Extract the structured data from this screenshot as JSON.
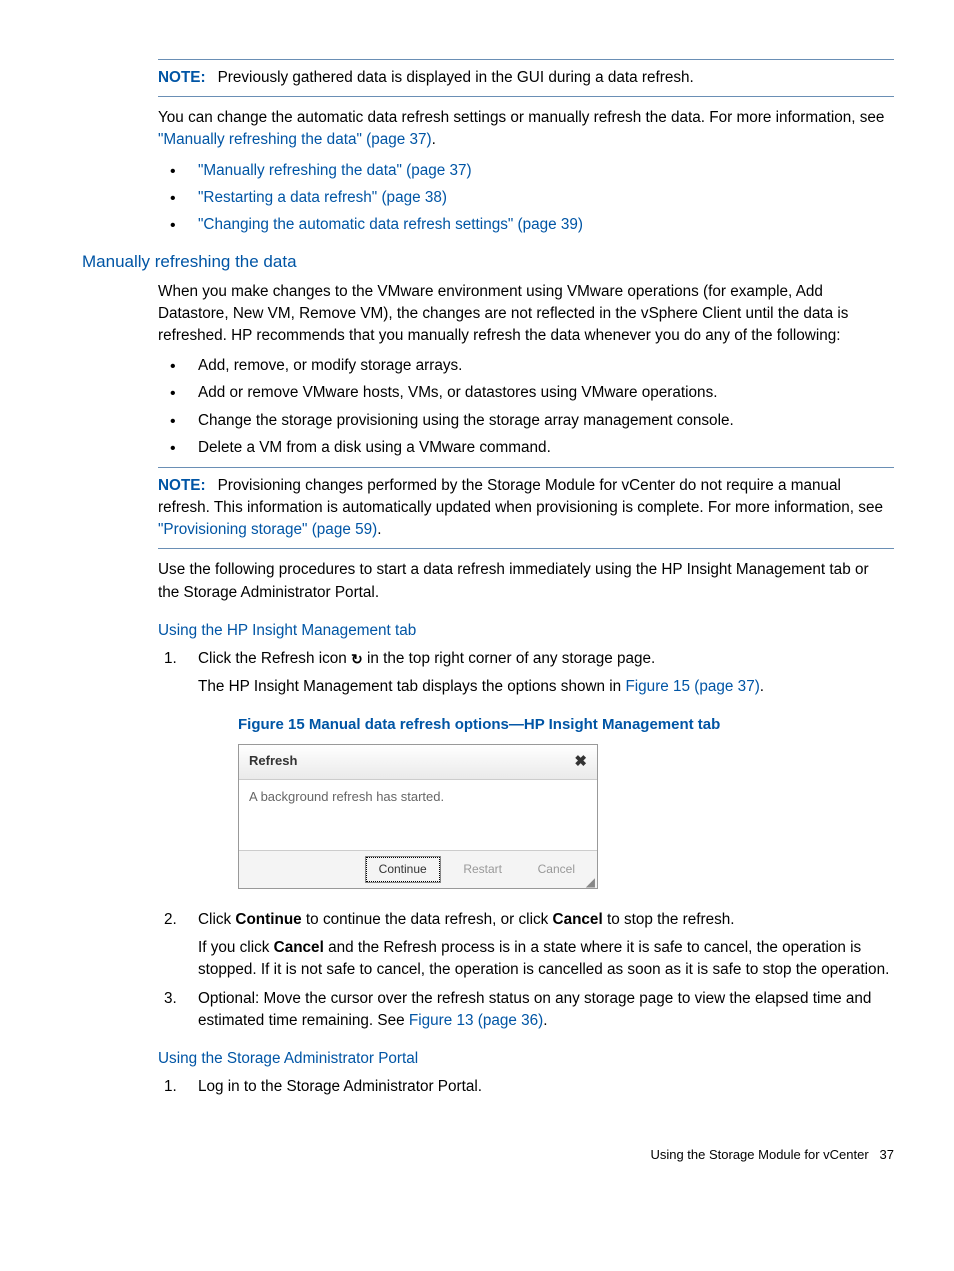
{
  "note1": {
    "label": "NOTE:",
    "text": "Previously gathered data is displayed in the GUI during a data refresh."
  },
  "para1a": "You can change the automatic data refresh settings or manually refresh the data. For more information, see ",
  "para1link": "\"Manually refreshing the data\" (page 37)",
  "para1b": ".",
  "top_links": [
    "\"Manually refreshing the data\" (page 37)",
    "\"Restarting a data refresh\" (page 38)",
    "\"Changing the automatic data refresh settings\" (page 39)"
  ],
  "section_title": "Manually refreshing the data",
  "section_intro": "When you make changes to the VMware environment using VMware operations (for example, Add Datastore, New VM, Remove VM), the changes are not reflected in the vSphere Client until the data is refreshed. HP recommends that you manually refresh the data whenever you do any of the following:",
  "section_bullets": [
    "Add, remove, or modify storage arrays.",
    "Add or remove VMware hosts, VMs, or datastores using VMware operations.",
    "Change the storage provisioning using the storage array management console.",
    "Delete a VM from a disk using a VMware command."
  ],
  "note2": {
    "label": "NOTE:",
    "texta": "Provisioning changes performed by the Storage Module for vCenter do not require a manual refresh. This information is automatically updated when provisioning is complete. For more information, see ",
    "link": "\"Provisioning storage\" (page 59)",
    "textb": "."
  },
  "para_procedures": "Use the following procedures to start a data refresh immediately using the HP Insight Management tab or the Storage Administrator Portal.",
  "sub1_title": "Using the HP Insight Management tab",
  "step1a": "Click the Refresh icon ",
  "step1b": " in the top right corner of any storage page.",
  "step1_p2a": "The HP Insight Management tab displays the options shown in ",
  "step1_p2link": "Figure 15 (page 37)",
  "step1_p2b": ".",
  "figure_caption": "Figure 15 Manual data refresh options—HP Insight Management tab",
  "dialog": {
    "title": "Refresh",
    "body": "A background refresh has started.",
    "continue": "Continue",
    "restart": "Restart",
    "cancel": "Cancel"
  },
  "step2a": "Click ",
  "step2b": "Continue",
  "step2c": " to continue the data refresh, or click ",
  "step2d": "Cancel",
  "step2e": " to stop the refresh.",
  "step2_p2a": "If you click ",
  "step2_p2b": "Cancel",
  "step2_p2c": " and the Refresh process is in a state where it is safe to cancel, the operation is stopped. If it is not safe to cancel, the operation is cancelled as soon as it is safe to stop the operation.",
  "step3a": "Optional: Move the cursor over the refresh status on any storage page to view the elapsed time and estimated time remaining. See ",
  "step3link": "Figure 13 (page 36)",
  "step3b": ".",
  "sub2_title": "Using the Storage Administrator Portal",
  "sub2_step1": "Log in to the Storage Administrator Portal.",
  "footer_text": "Using the Storage Module for vCenter",
  "footer_page": "37"
}
